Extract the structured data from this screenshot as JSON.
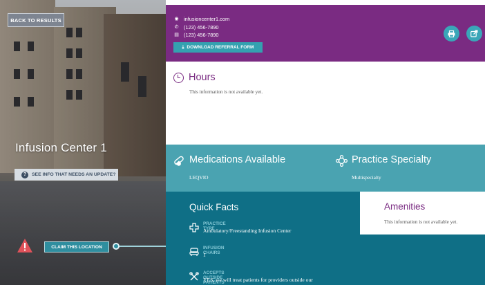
{
  "nav": {
    "back_label": "BACK TO RESULTS"
  },
  "location": {
    "name": "Infusion Center 1",
    "update_label": "SEE INFO THAT NEEDS AN UPDATE?",
    "claim_label": "CLAIM THIS LOCATION"
  },
  "contact": {
    "website": "infusioncenter1.com",
    "phone": "(123) 456-7890",
    "fax": "(123) 456-7890",
    "download_label": "DOWNLOAD REFERRAL FORM"
  },
  "hours": {
    "title": "Hours",
    "text": "This information is not available yet."
  },
  "medications": {
    "title": "Medications Available",
    "value": "LEQVIO"
  },
  "specialty": {
    "title": "Practice Specialty",
    "value": "Multispecialty"
  },
  "quick_facts": {
    "title": "Quick Facts",
    "items": [
      {
        "label": "PRACTICE TYPE",
        "value": "Ambulatory/Freestanding Infusion Center",
        "icon": "medical-cross-icon"
      },
      {
        "label": "INFUSION CHAIRS",
        "value": "1",
        "icon": "chair-icon"
      },
      {
        "label": "ACCEPTS OUTSIDE PATIENTS",
        "value": "YES, we will treat patients for providers outside our",
        "icon": "tools-icon"
      }
    ]
  },
  "amenities": {
    "title": "Amenities",
    "text": "This information is not available yet."
  },
  "colors": {
    "purple": "#7a2b82",
    "teal": "#4aa3b1",
    "dark_teal": "#0f6f86",
    "button_teal": "#34a1b0",
    "warning_red": "#e0525a"
  }
}
